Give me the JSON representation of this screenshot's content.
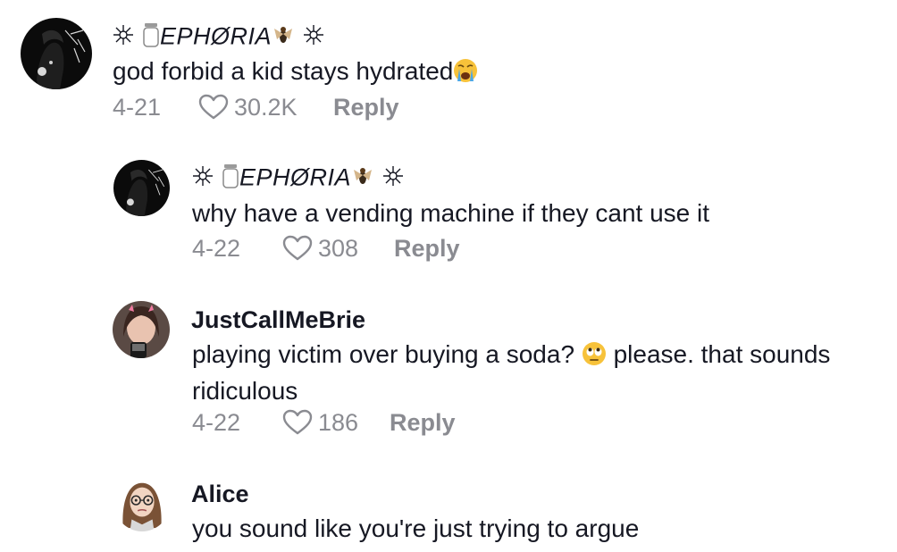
{
  "comments": [
    {
      "username": "EPHØRIA",
      "text": "god forbid a kid stays hydrated",
      "text_emoji": "loudly-crying-face",
      "date": "4-21",
      "likes": "30.2K",
      "reply_label": "Reply"
    },
    {
      "username": "EPHØRIA",
      "text": "why have a vending machine if they cant use it",
      "date": "4-22",
      "likes": "308",
      "reply_label": "Reply"
    },
    {
      "username": "JustCallMeBrie",
      "text_before_emoji": "playing victim over buying a soda?",
      "text_emoji": "face-with-rolling-eyes",
      "text_after_emoji": "please. that sounds ridiculous",
      "date": "4-22",
      "likes": "186",
      "reply_label": "Reply"
    },
    {
      "username": "Alice",
      "text": "you sound like you're just trying to argue"
    }
  ],
  "colors": {
    "text": "#161823",
    "meta": "#8a8b91",
    "heart_outline": "#8a8b91"
  },
  "icons": {
    "like": "heart-outline-icon",
    "username_decorations": [
      "sparkle-icon",
      "jar-icon",
      "fly-icon",
      "sparkle-icon"
    ]
  }
}
